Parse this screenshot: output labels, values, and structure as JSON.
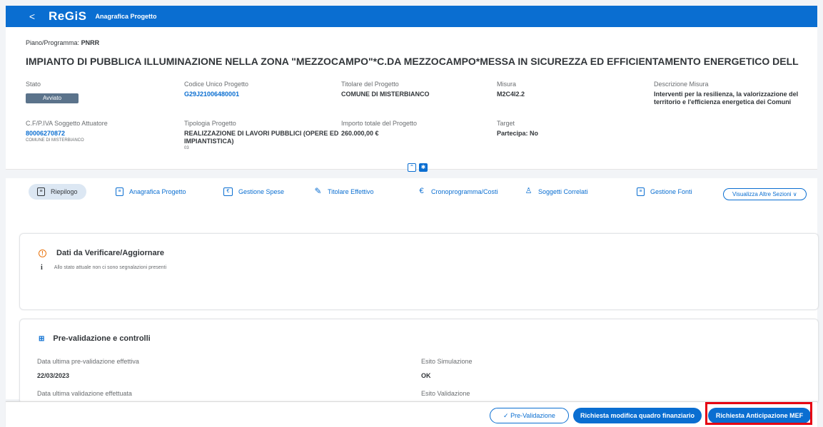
{
  "shell": {
    "back": "<",
    "logo": "ReGiS",
    "title": "Anagrafica Progetto"
  },
  "header": {
    "piano_label": "Piano/Programma:",
    "piano_value": "PNRR",
    "title": "IMPIANTO DI PUBBLICA ILLUMINAZIONE NELLA ZONA \"MEZZOCAMPO\"*C.DA MEZZOCAMPO*MESSA IN SICUREZZA ED EFFICIENTAMENTO ENERGETICO DELL",
    "stato_label": "Stato",
    "stato_value": "Avviato",
    "cup_label": "Codice Unico Progetto",
    "cup_value": "G29J21006480001",
    "titolare_label": "Titolare del Progetto",
    "titolare_value": "COMUNE DI MISTERBIANCO",
    "misura_label": "Misura",
    "misura_value": "M2C4I2.2",
    "descr_label": "Descrizione Misura",
    "descr_value": "Interventi per la resilienza, la valorizzazione del territorio e l'efficienza energetica dei Comuni",
    "cf_label": "C.F/P.IVA Soggetto Attuatore",
    "cf_value": "80006270872",
    "cf_sub": "COMUNE DI MISTERBIANCO",
    "tipologia_label": "Tipologia Progetto",
    "tipologia_value": "REALIZZAZIONE DI LAVORI PUBBLICI (OPERE ED IMPIANTISTICA)",
    "tipologia_sub": "03",
    "importo_label": "Importo totale del Progetto",
    "importo_value": "260.000,00 €",
    "target_label": "Target",
    "target_value": "Partecipa: No"
  },
  "tabs": {
    "riepilogo": "Riepilogo",
    "anagrafica": "Anagrafica Progetto",
    "spese": "Gestione Spese",
    "titolare": "Titolare Effettivo",
    "crono": "Cronoprogramma/Costi",
    "soggetti": "Soggetti Correlati",
    "fonti": "Gestione Fonti",
    "altre": "Visualizza Altre Sezioni ∨"
  },
  "card1": {
    "title": "Dati da Verificare/Aggiornare",
    "info": "Allo stato attuale non ci sono segnalazioni presenti"
  },
  "card2": {
    "title": "Pre-validazione e controlli",
    "prevalid_label": "Data ultima pre-validazione effettiva",
    "prevalid_value": "22/03/2023",
    "simul_label": "Esito Simulazione",
    "simul_value": "OK",
    "valid_label": "Data ultima validazione effettuata",
    "esito_valid_label": "Esito Validazione"
  },
  "footer": {
    "prevalidazione": "✓  Pre-Validazione",
    "modifica": "Richiesta modifica quadro finanziario",
    "anticipazione": "Richiesta Anticipazione MEF"
  },
  "colors": {
    "brand": "#0a6ed1",
    "highlight": "#e60012",
    "status": "#5b738b"
  }
}
